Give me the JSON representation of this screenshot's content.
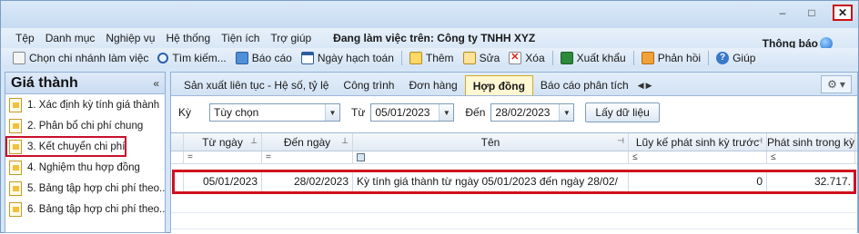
{
  "window": {
    "minimize": "‒",
    "maximize": "□",
    "close": "✕"
  },
  "menu": {
    "items": [
      "Tệp",
      "Danh mục",
      "Nghiệp vụ",
      "Hệ thống",
      "Tiện ích",
      "Trợ giúp"
    ],
    "working_on": "Đang làm việc trên: Công ty TNHH XYZ",
    "notification": "Thông báo"
  },
  "toolbar": {
    "branch": "Chọn chi nhánh làm việc",
    "search": "Tìm kiếm...",
    "report": "Báo cáo",
    "posting_date": "Ngày hạch toán",
    "add": "Thêm",
    "edit": "Sửa",
    "delete": "Xóa",
    "export": "Xuất khẩu",
    "feedback": "Phản hồi",
    "help": "Giúp"
  },
  "left_panel": {
    "title": "Giá thành",
    "collapse": "«",
    "items": [
      {
        "label": "1. Xác định kỳ tính giá thành"
      },
      {
        "label": "2. Phân bổ chi phí chung"
      },
      {
        "label": "3. Kết chuyển chi phí"
      },
      {
        "label": "4. Nghiệm thu hợp đồng"
      },
      {
        "label": "5. Bảng tập hợp chi phí theo..."
      },
      {
        "label": "6. Bảng tập hợp chi phí theo..."
      }
    ],
    "selected_index": 2
  },
  "tabs": {
    "items": [
      "Sản xuất liên tục - Hệ số, tỷ lệ",
      "Công trình",
      "Đơn hàng",
      "Hợp đồng",
      "Báo cáo phân tích"
    ],
    "active": "Hợp đồng",
    "prev": "◀",
    "next": "▶",
    "gear": "⚙",
    "gear_dd": "▾"
  },
  "filter": {
    "period_label": "Kỳ",
    "period_value": "Tùy chọn",
    "from_label": "Từ",
    "from_value": "05/01/2023",
    "to_label": "Đến",
    "to_value": "28/02/2023",
    "fetch_button": "Lấy dữ liệu"
  },
  "grid": {
    "columns": [
      "Từ ngày",
      "Đến ngày",
      "Tên",
      "Lũy kế phát sinh kỳ trước",
      "Phát sinh trong kỳ"
    ],
    "filter_ops": [
      "=",
      "=",
      "",
      "≤",
      "≤"
    ],
    "rows": [
      {
        "from": "05/01/2023",
        "to": "28/02/2023",
        "name": "Kỳ tính giá thành từ ngày 05/01/2023 đến ngày 28/02/",
        "prior": "0",
        "current": "32.717."
      }
    ]
  },
  "colors": {
    "highlight": "#d0101f",
    "active_tab": "#fff8d2",
    "accent": "#2b5ea8"
  }
}
